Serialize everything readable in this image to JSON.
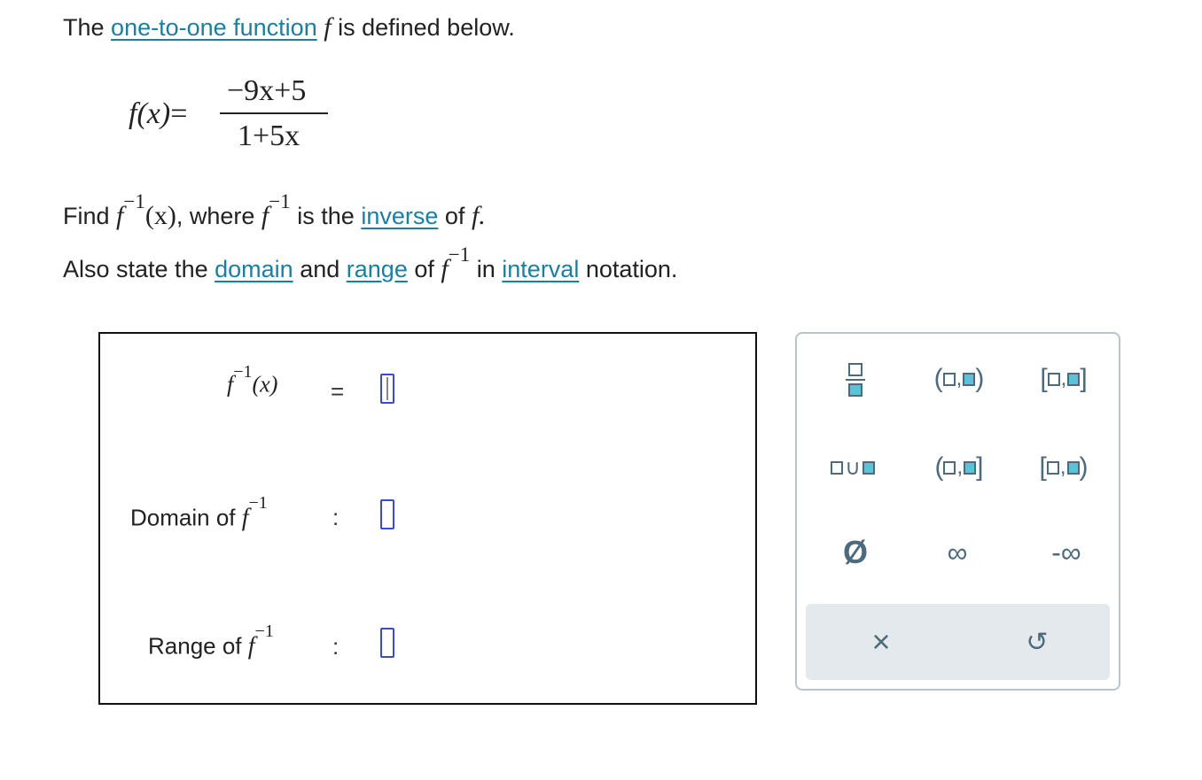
{
  "problem": {
    "intro_prefix": "The",
    "intro_link": "one-to-one function",
    "intro_f": "f",
    "intro_suffix": "is defined below.",
    "formula_lhs": "f(x)",
    "formula_eq": "=",
    "numerator": "−9x+5",
    "denominator": "1+5x",
    "find_prefix": "Find",
    "f": "f",
    "inv_exp": "−1",
    "x_arg": "(x)",
    "where": ", where",
    "is_the": "is the",
    "inverse_link": "inverse",
    "of_f_text": "of",
    "f_period": "f.",
    "also_prefix": "Also state the",
    "domain_link": "domain",
    "and_text": "and",
    "range_link": "range",
    "of_text": "of",
    "in_text": "in",
    "interval_link": "interval",
    "notation_text": "notation."
  },
  "answer": {
    "inverse_label_f": "f",
    "inverse_label_exp": "−1",
    "inverse_label_x": "(x)",
    "equals": "=",
    "domain_label": "Domain of",
    "range_label": "Range of",
    "f": "f",
    "exp": "−1",
    "colon": ":"
  },
  "palette": {
    "union_symbol": "∪",
    "comma": ",",
    "open_paren": "(",
    "close_paren": ")",
    "open_bracket": "[",
    "close_bracket": "]",
    "empty_set": "Ø",
    "infinity": "∞",
    "neg_infinity": "-∞",
    "clear": "×",
    "undo": "↺",
    "icons": [
      "fraction-icon",
      "union-icon",
      "empty-set-icon",
      "infinity-icon",
      "negative-infinity-icon",
      "clear-icon",
      "undo-icon"
    ]
  },
  "colors": {
    "link": "#1a7fa0",
    "slot_border": "#3a48e0",
    "palette_icon": "#4d6b7c",
    "palette_teal": "#5ec2d6",
    "action_bar": "#e3e9ec"
  }
}
